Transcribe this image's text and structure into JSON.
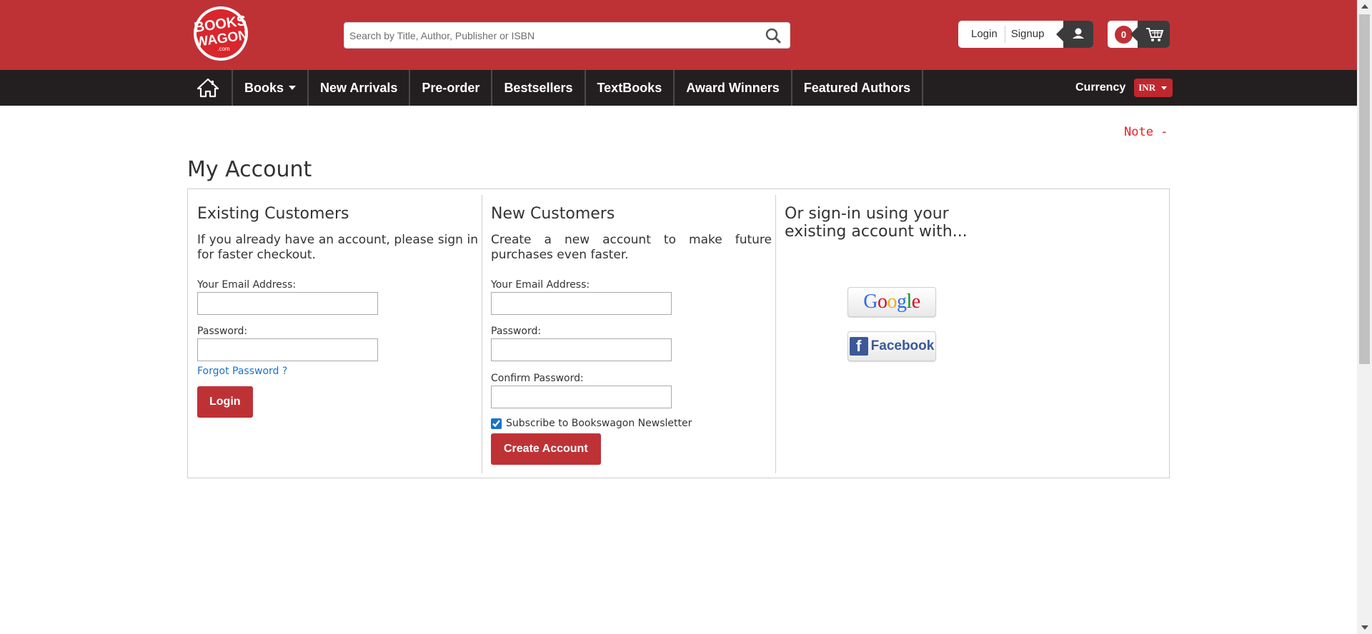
{
  "header": {
    "logo_text": "BOOKS WAGON .com",
    "search_placeholder": "Search by Title, Author, Publisher or ISBN",
    "login_label": "Login",
    "signup_label": "Signup",
    "cart_count": "0"
  },
  "nav": {
    "items": [
      {
        "label": "Books"
      },
      {
        "label": "New Arrivals"
      },
      {
        "label": "Pre-order"
      },
      {
        "label": "Bestsellers"
      },
      {
        "label": "TextBooks"
      },
      {
        "label": "Award Winners"
      },
      {
        "label": "Featured Authors"
      }
    ],
    "currency_label": "Currency",
    "currency_value": "INR"
  },
  "notice": "Note - D",
  "page_title": "My Account",
  "existing": {
    "heading": "Existing Customers",
    "description": "If you already have an account, please sign in for faster checkout.",
    "email_label": "Your Email Address:",
    "password_label": "Password:",
    "forgot_label": "Forgot Password ?",
    "login_button": "Login"
  },
  "new_customers": {
    "heading": "New Customers",
    "description": "Create a new account to make future purchases even faster.",
    "email_label": "Your Email Address:",
    "password_label": "Password:",
    "confirm_label": "Confirm Password:",
    "newsletter_label": "Subscribe to Bookswagon Newsletter",
    "newsletter_checked": true,
    "create_button": "Create Account"
  },
  "social": {
    "heading": "Or sign-in using your existing account with...",
    "google_label": "Google",
    "facebook_label": "Facebook"
  },
  "colors": {
    "brand_red": "#be3236",
    "nav_dark": "#231f20",
    "link_blue": "#1a73c7",
    "notice_red": "#ed1c24"
  }
}
